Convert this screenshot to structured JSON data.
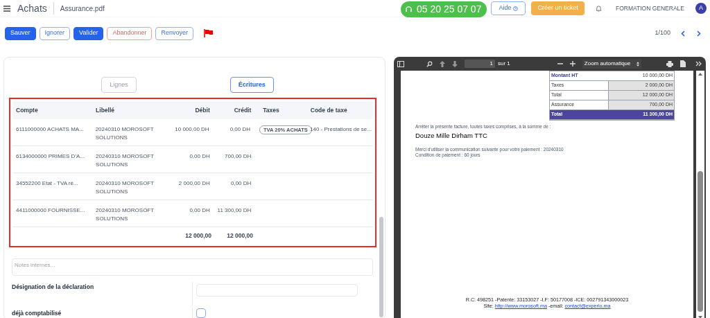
{
  "header": {
    "title": "Achats",
    "file": "Assurance.pdf",
    "phone": "05 20 25 07 07",
    "help": "Aide",
    "ticket": "Créer un ticket",
    "company": "FORMATION GENERALE",
    "avatar": "A"
  },
  "toolbar": {
    "buttons": [
      {
        "label": "Sauver",
        "kind": "primary"
      },
      {
        "label": "Ignorer",
        "kind": "outline"
      },
      {
        "label": "Valider",
        "kind": "primary"
      },
      {
        "label": "Abandonner",
        "kind": "danger"
      },
      {
        "label": "Renvoyer",
        "kind": "outline"
      }
    ],
    "pager": "1/100"
  },
  "tabs": [
    {
      "label": "Lignes",
      "selected": false
    },
    {
      "label": "Écritures",
      "selected": true
    }
  ],
  "table": {
    "columns": [
      "Compte",
      "Libellé",
      "Débit",
      "Crédit",
      "Taxes",
      "Code de taxe"
    ],
    "rows": [
      {
        "account": "6111000000 ACHATS MA...",
        "label": "20240310 MOROSOFT SOLUTIONS",
        "debit": "10 000,00 DH",
        "credit": "0,00 DH",
        "tax": "TVA 20% ACHATS",
        "tax_code": "140 - Prestations de se..."
      },
      {
        "account": "6134000000 PRIMES D'A...",
        "label": "20240310 MOROSOFT SOLUTIONS",
        "debit": "0,00 DH",
        "credit": "700,00 DH"
      },
      {
        "account": "34552200 Etat - TVA ré...",
        "label": "20240310 MOROSOFT SOLUTIONS",
        "debit": "2 000,00 DH",
        "credit": "0,00 DH"
      },
      {
        "account": "4411000000 FOURNISSE...",
        "label": "20240310 MOROSOFT SOLUTIONS",
        "debit": "0,00 DH",
        "credit": "11 300,00 DH"
      }
    ],
    "totals": {
      "debit": "12 000,00",
      "credit": "12 000,00"
    }
  },
  "notes": {
    "placeholder": "Notes internes..."
  },
  "fields": [
    {
      "label": "Désignation de la déclaration",
      "kind": "text"
    },
    {
      "label": "déjà comptabilisé",
      "kind": "checkbox",
      "checked": false
    }
  ],
  "pdf_viewer": {
    "page": "1",
    "page_count": "sur 1",
    "zoom": "Zoom automatique",
    "summary": [
      {
        "label": "Montant HT",
        "value": "10 000,00 DH",
        "kind": "head"
      },
      {
        "label": "Taxes",
        "value": "2 000,00 DH",
        "kind": "normal"
      },
      {
        "label": "Total",
        "value": "12 000,00 DH",
        "kind": "normal"
      },
      {
        "label": "Assurance",
        "value": "700,00 DH",
        "kind": "normal"
      },
      {
        "label": "Total",
        "value": "11 300,00 DH",
        "kind": "grand"
      }
    ],
    "amount_intro": "Arrêter la présente facture, toutes taxes comprises, à la somme de :",
    "amount_words": "Douze Mille Dirham TTC",
    "payment_lines": [
      "Merci d'utiliser la communication suivante pour votre paiement : 20240310",
      "Condition de paiement : 60 jours"
    ],
    "footer": {
      "line1": "R.C: 498251 -Patente: 33153027 -I.F: 50177008 -ICE: 002791343000023",
      "site_label": "Site:",
      "site": "http://www.morosoft.ma",
      "email_label": "-email:",
      "email": "contact@experio.ma"
    }
  }
}
